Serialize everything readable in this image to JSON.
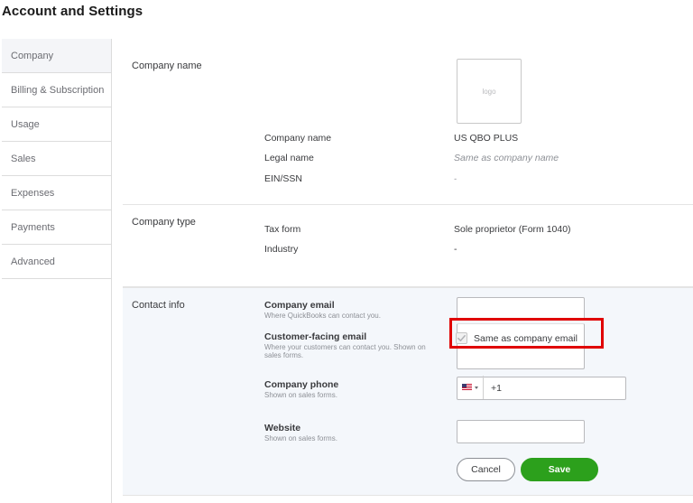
{
  "page_title": "Account and Settings",
  "sidebar": {
    "items": [
      {
        "label": "Company"
      },
      {
        "label": "Billing & Subscription"
      },
      {
        "label": "Usage"
      },
      {
        "label": "Sales"
      },
      {
        "label": "Expenses"
      },
      {
        "label": "Payments"
      },
      {
        "label": "Advanced"
      }
    ]
  },
  "company_name_section": {
    "label": "Company name",
    "logo_placeholder": "logo",
    "rows": [
      {
        "label": "Company name",
        "value": "US QBO PLUS"
      },
      {
        "label": "Legal name",
        "value": "Same as company name"
      },
      {
        "label": "EIN/SSN",
        "value": "-"
      }
    ]
  },
  "company_type_section": {
    "label": "Company type",
    "rows": [
      {
        "label": "Tax form",
        "value": "Sole proprietor (Form 1040)"
      },
      {
        "label": "Industry",
        "value": "-"
      }
    ]
  },
  "contact_section": {
    "label": "Contact info",
    "company_email": {
      "title": "Company email",
      "sub": "Where QuickBooks can contact you.",
      "value": ""
    },
    "customer_email": {
      "title": "Customer-facing email",
      "sub": "Where your customers can contact you. Shown on sales forms.",
      "checkbox_label": "Same as company email",
      "checked": true
    },
    "company_phone": {
      "title": "Company phone",
      "sub": "Shown on sales forms.",
      "value": "+1"
    },
    "website": {
      "title": "Website",
      "sub": "Shown on sales forms.",
      "value": ""
    },
    "cancel_label": "Cancel",
    "save_label": "Save"
  },
  "colors": {
    "save_green": "#2ca01c",
    "highlight_red": "#e00000"
  }
}
